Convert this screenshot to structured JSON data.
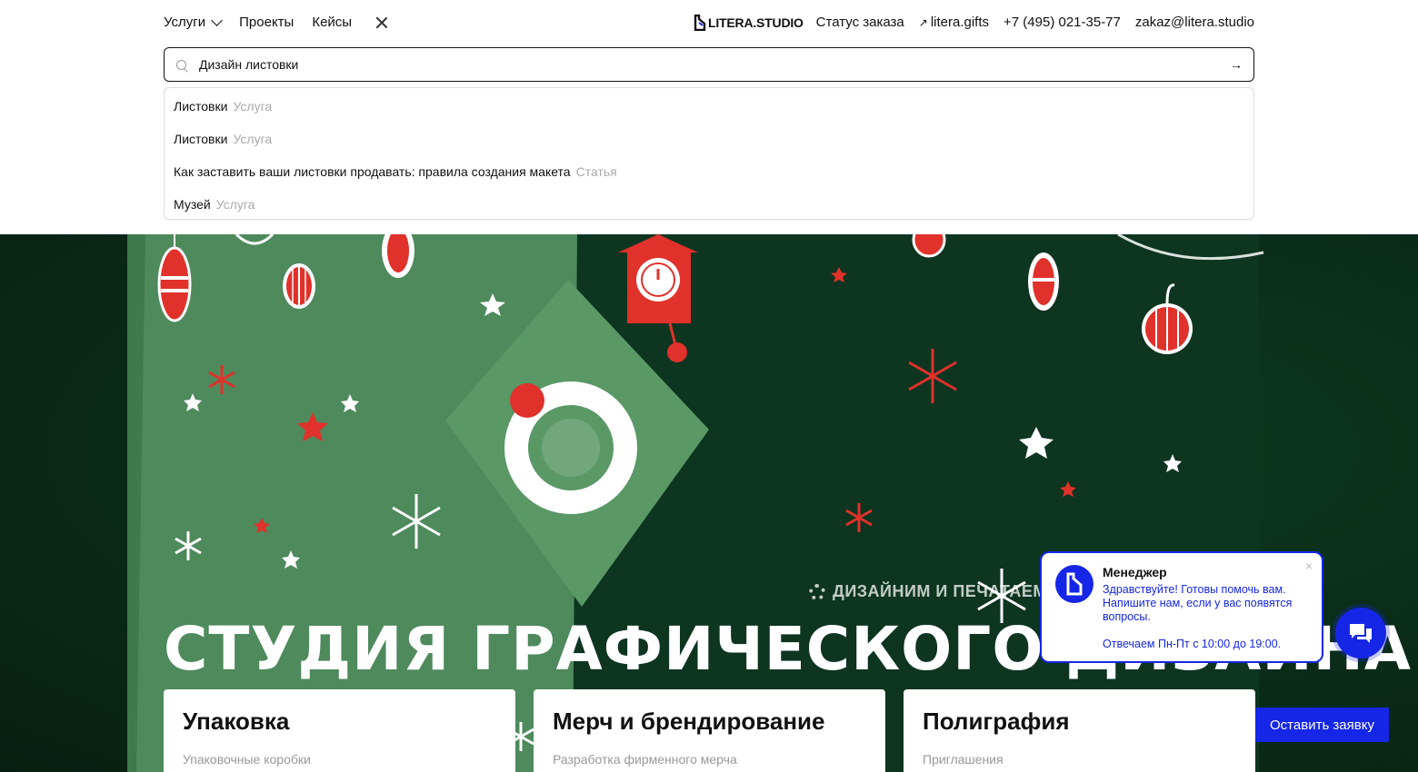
{
  "nav": {
    "services": "Услуги",
    "projects": "Проекты",
    "cases": "Кейсы"
  },
  "logo": {
    "text": "LITERA.STUDIO"
  },
  "nav_right": {
    "order_status": "Статус заказа",
    "gifts": "litera.gifts",
    "phone": "+7 (495) 021-35-77",
    "email": "zakaz@litera.studio"
  },
  "search": {
    "value": "Дизайн листовки"
  },
  "suggestions": [
    {
      "title": "Листовки",
      "type": "Услуга"
    },
    {
      "title": "Листовки",
      "type": "Услуга"
    },
    {
      "title": "Как заставить ваши листовки продавать: правила создания макета",
      "type": "Статья"
    },
    {
      "title": "Музей",
      "type": "Услуга"
    }
  ],
  "hero": {
    "tagline": "ДИЗАЙНИМ И ПЕЧАТАЕМ Н",
    "title": "СТУДИЯ ГРАФИЧЕСКОГО ДИЗАЙНА"
  },
  "cards": [
    {
      "title": "Упаковка",
      "subtitle": "Упаковочные коробки"
    },
    {
      "title": "Мерч и брендирование",
      "subtitle": "Разработка фирменного мерча"
    },
    {
      "title": "Полиграфия",
      "subtitle": "Приглашения"
    }
  ],
  "chat": {
    "name": "Менеджер",
    "message": "Здравствуйте! Готовы помочь вам. Напишите нам, если у вас появятся вопросы.",
    "hours": "Отвечаем Пн-Пт с 10:00 до 19:00.",
    "close": "×"
  },
  "order_button": "Оставить заявку",
  "colors": {
    "accent": "#1526e6",
    "hero_green": "#0f3d23",
    "box_green": "#4e8a5c",
    "red": "#e0312b"
  }
}
